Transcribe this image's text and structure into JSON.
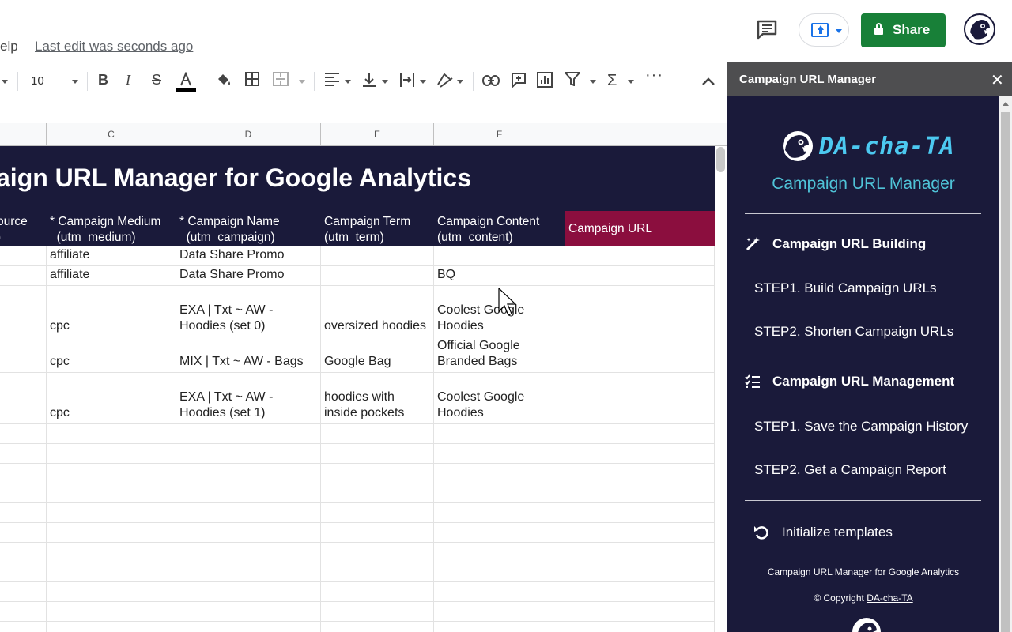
{
  "header": {
    "menu_help": "elp",
    "last_edit": "Last edit was seconds ago",
    "share_label": "Share"
  },
  "toolbar": {
    "font_size": "10"
  },
  "grid": {
    "columns": [
      "C",
      "D",
      "E",
      "F"
    ],
    "title": "aign URL Manager for Google Analytics",
    "headers": {
      "source": [
        "ource",
        ")"
      ],
      "medium": [
        "* Campaign Medium",
        "  (utm_medium)"
      ],
      "name": [
        "* Campaign Name",
        "  (utm_campaign)"
      ],
      "term": [
        "Campaign Term",
        "(utm_term)"
      ],
      "content": [
        "Campaign Content",
        "(utm_content)"
      ],
      "url": "Campaign URL"
    },
    "rows": [
      {
        "medium": "affiliate",
        "name": [
          "Data Share Promo"
        ],
        "term": [],
        "content": []
      },
      {
        "medium": "affiliate",
        "name": [
          "Data Share Promo"
        ],
        "term": [],
        "content": [
          "BQ"
        ]
      },
      {
        "medium": "cpc",
        "name": [
          "EXA | Txt ~ AW -",
          "Hoodies (set 0)"
        ],
        "term": [
          "oversized hoodies"
        ],
        "content": [
          "Coolest Google",
          "Hoodies"
        ]
      },
      {
        "medium": "cpc",
        "name": [
          "MIX | Txt ~ AW - Bags"
        ],
        "term": [
          "Google Bag"
        ],
        "content": [
          "Official Google",
          "Branded Bags"
        ]
      },
      {
        "medium": "cpc",
        "name": [
          "EXA | Txt ~ AW -",
          "Hoodies (set 1)"
        ],
        "term": [
          "hoodies with",
          "inside pockets"
        ],
        "content": [
          "Coolest Google",
          "Hoodies"
        ]
      }
    ]
  },
  "panel": {
    "title": "Campaign URL Manager",
    "close": "✕",
    "brand": "DA-cha-TA",
    "subtitle": "Campaign URL Manager",
    "section_building": "Campaign URL Building",
    "step_build": "STEP1. Build Campaign URLs",
    "step_shorten": "STEP2. Shorten Campaign URLs",
    "section_management": "Campaign URL Management",
    "step_save": "STEP1. Save the Campaign History",
    "step_report": "STEP2. Get a Campaign Report",
    "initialize": "Initialize templates",
    "footer_title": "Campaign URL Manager for Google Analytics",
    "copyright": "© Copyright ",
    "copyright_link": "DA-cha-TA"
  },
  "colors": {
    "panel_bg": "#1a1a3a",
    "url_header_bg": "#8b0e3e",
    "share_green": "#188038",
    "brand_cyan": "#4cc9f0"
  }
}
